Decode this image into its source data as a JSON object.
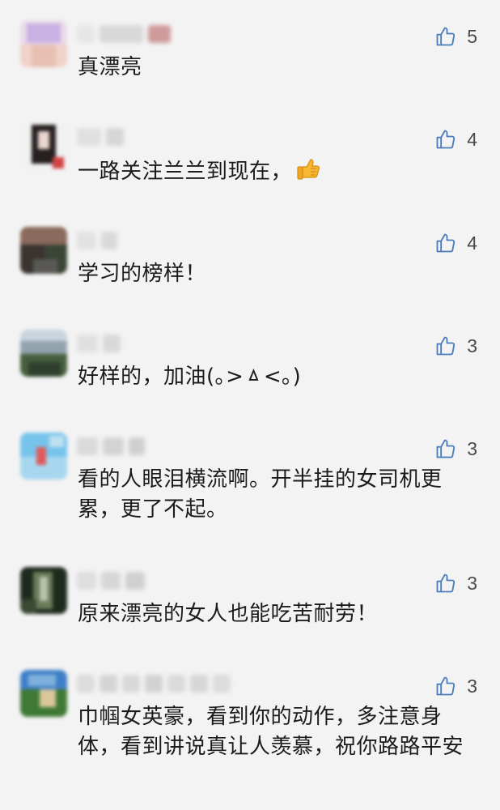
{
  "comments": [
    {
      "text": "真漂亮",
      "likes": "5",
      "avatar_colors": [
        "#e9dbe9",
        "#c9b2e4",
        "#f1d2c9",
        "#e7c0b3"
      ],
      "nick_colors": [
        "#e6e6e6",
        "#d8d8d8",
        "#cf9a9a"
      ]
    },
    {
      "text": "一路关注兰兰到现在，",
      "emoji": "thumbs-up-icon",
      "likes": "4",
      "avatar_colors": [
        "#f1f1f1",
        "#272020",
        "#e9d6d0",
        "#d34444"
      ],
      "nick_colors": [
        "#e0e0e0",
        "#d6d6d6"
      ]
    },
    {
      "text": "学习的榜样！",
      "likes": "4",
      "avatar_colors": [
        "#8a6a5c",
        "#3a332f",
        "#3a4536",
        "#5a5854"
      ],
      "nick_colors": [
        "#e2e2e2",
        "#d9d9d9"
      ]
    },
    {
      "text": "好样的，加油(｡>ㅿ<｡)",
      "likes": "3",
      "avatar_colors": [
        "#c9d5de",
        "#92a3ae",
        "#46603d",
        "#2f3f2e"
      ],
      "nick_colors": [
        "#e0e0e0",
        "#d8d8d8"
      ]
    },
    {
      "text": "看的人眼泪横流啊。开半挂的女司机更累，更了不起。",
      "likes": "3",
      "avatar_colors": [
        "#76c4ec",
        "#a7d7ef",
        "#e05a5a",
        "#bfe0ef"
      ],
      "nick_colors": [
        "#dadada",
        "#d3d3d3",
        "#cfcfcf"
      ]
    },
    {
      "text": "原来漂亮的女人也能吃苦耐劳！",
      "likes": "3",
      "avatar_colors": [
        "#1f2a1e",
        "#6a7b58",
        "#b9c2ad",
        "#3b4a33"
      ],
      "nick_colors": [
        "#dedede",
        "#d6d6d6",
        "#d0d0d0"
      ]
    },
    {
      "text": "巾帼女英豪，看到你的动作，多注意身体，看到讲说真让人羡慕，祝你路路平安",
      "likes": "3",
      "avatar_colors": [
        "#3e7fc7",
        "#7fb0dd",
        "#3f7a34",
        "#d9c79a"
      ],
      "nick_colors": [
        "#dcdcdc",
        "#d4d4d4",
        "#d8d8d8",
        "#d2d2d2",
        "#dadada",
        "#d6d6d6",
        "#dcdcdc"
      ]
    }
  ],
  "colors": {
    "background": "#f3f3f3",
    "text": "#1b1b1b",
    "like_icon": "#4c7dbd",
    "like_count": "#4a4a4a"
  }
}
